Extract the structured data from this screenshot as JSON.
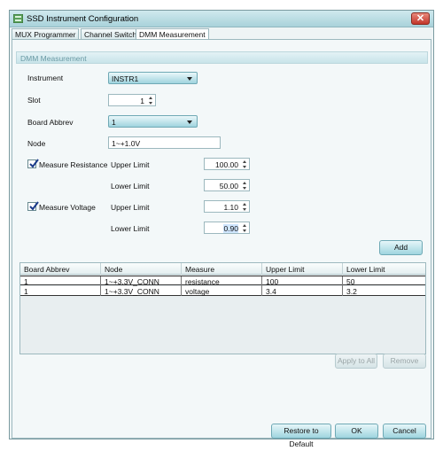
{
  "window": {
    "title": "SSD Instrument Configuration",
    "close_label": "✕"
  },
  "tabs": [
    {
      "label": "MUX Programmer",
      "active": false
    },
    {
      "label": "Channel Switch",
      "active": false
    },
    {
      "label": "DMM Measurement",
      "active": true
    }
  ],
  "group": {
    "title": "DMM Measurement"
  },
  "form": {
    "instrument": {
      "label": "Instrument",
      "value": "INSTR1"
    },
    "slot": {
      "label": "Slot",
      "value": "1"
    },
    "board_abbrev": {
      "label": "Board Abbrev",
      "value": "1"
    },
    "node": {
      "label": "Node",
      "value": "1~+1.0V"
    },
    "measure_resistance": {
      "label": "Measure Resistance",
      "checked": true,
      "upper_label": "Upper Limit",
      "upper_value": "100.00",
      "lower_label": "Lower Limit",
      "lower_value": "50.00"
    },
    "measure_voltage": {
      "label": "Measure Voltage",
      "checked": true,
      "upper_label": "Upper Limit",
      "upper_value": "1.10",
      "lower_label": "Lower Limit",
      "lower_value": "0.90"
    },
    "add_label": "Add"
  },
  "table": {
    "columns": [
      "Board Abbrev",
      "Node",
      "Measure",
      "Upper Limit",
      "Lower Limit"
    ],
    "rows": [
      [
        "1",
        "1~+3.3V_CONN",
        "resistance",
        "100",
        "50"
      ],
      [
        "1",
        "1~+3.3V_CONN",
        "voltage",
        "3.4",
        "3.2"
      ]
    ]
  },
  "actions": {
    "apply_to_all": "Apply to All",
    "remove": "Remove",
    "restore_defaults": "Restore to Default",
    "ok": "OK",
    "cancel": "Cancel"
  },
  "colors": {
    "accent": "#9fd3de",
    "title_bar": "#a9d2da",
    "close": "#c2352a"
  }
}
